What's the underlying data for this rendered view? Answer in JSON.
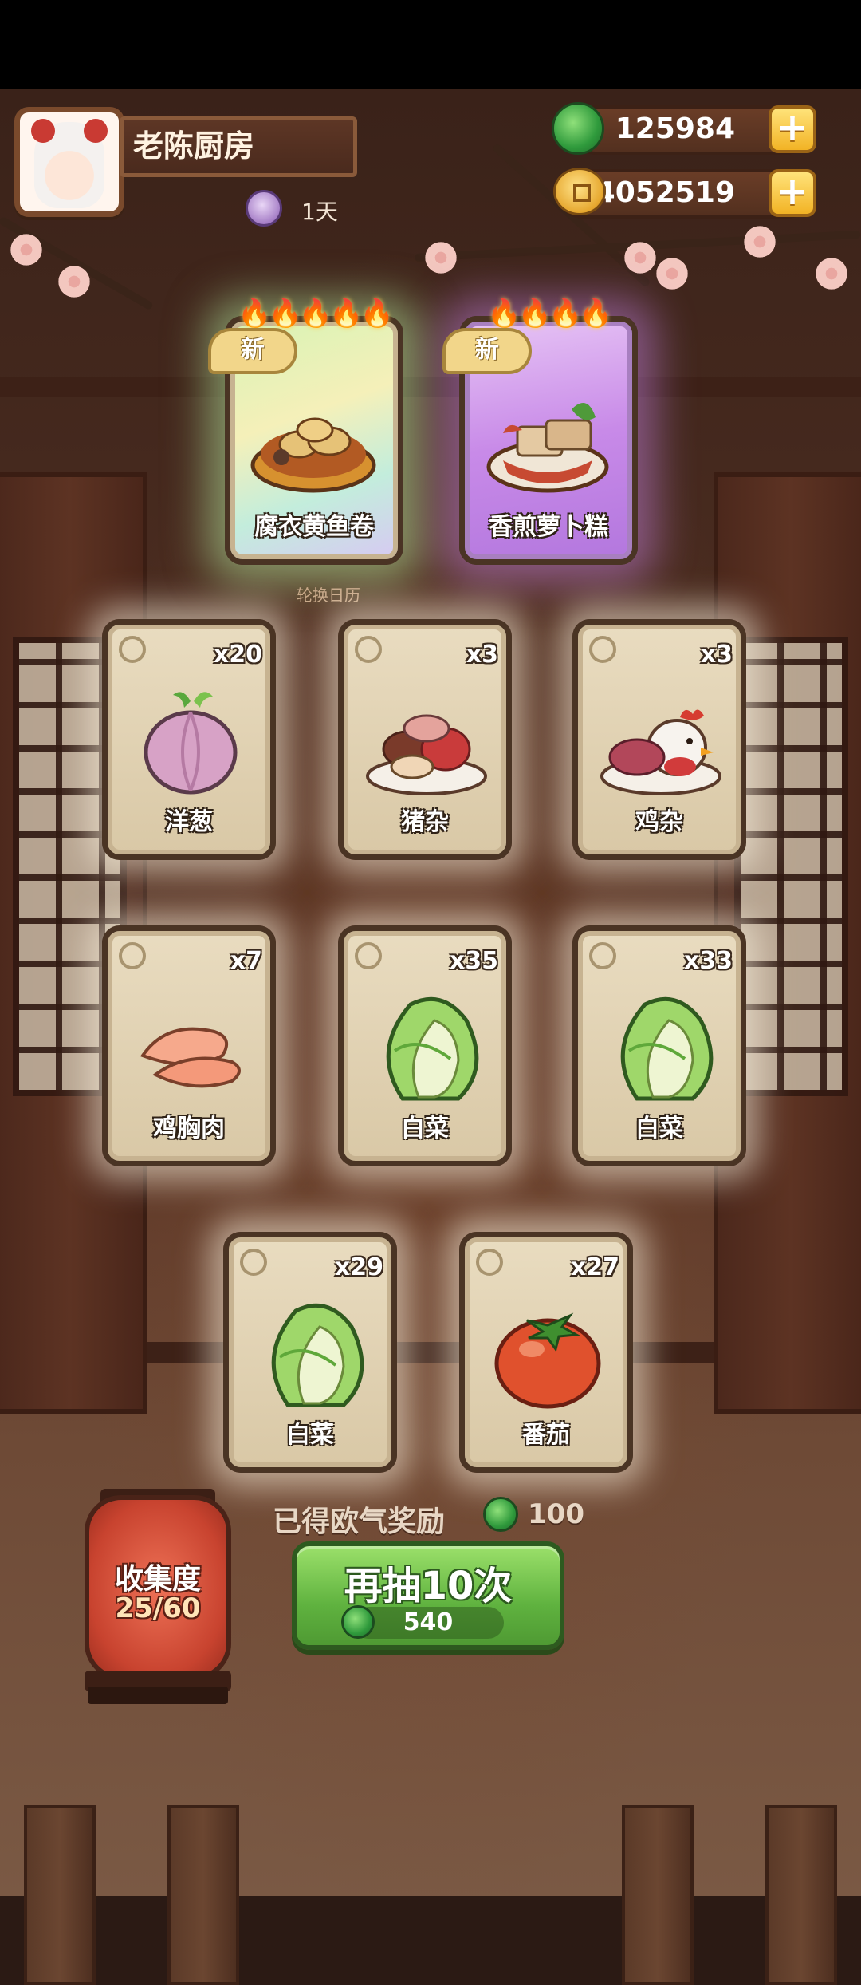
{
  "header": {
    "restaurant_name": "老陈厨房",
    "day_label": "1天"
  },
  "currencies": {
    "jade": {
      "value": "125984",
      "icon": "jade-icon"
    },
    "gold": {
      "value": "34052519",
      "icon": "coin-icon"
    }
  },
  "featured": {
    "rotate_label": "轮换日历",
    "cards": [
      {
        "label": "腐衣黄鱼卷",
        "badge": "新",
        "stars": 5,
        "color": "#c7f2a8"
      },
      {
        "label": "香煎萝卜糕",
        "badge": "新",
        "stars": 4,
        "color": "#c88ae8"
      }
    ]
  },
  "cards": [
    {
      "label": "洋葱",
      "qty": "x20",
      "icon": "onion-icon"
    },
    {
      "label": "猪杂",
      "qty": "x3",
      "icon": "pork-offal-icon"
    },
    {
      "label": "鸡杂",
      "qty": "x3",
      "icon": "chicken-offal-icon"
    },
    {
      "label": "鸡胸肉",
      "qty": "x7",
      "icon": "chicken-breast-icon"
    },
    {
      "label": "白菜",
      "qty": "x35",
      "icon": "cabbage-icon"
    },
    {
      "label": "白菜",
      "qty": "x33",
      "icon": "cabbage-icon"
    },
    {
      "label": "白菜",
      "qty": "x29",
      "icon": "cabbage-icon"
    },
    {
      "label": "番茄",
      "qty": "x27",
      "icon": "tomato-icon"
    }
  ],
  "reward": {
    "label": "已得欧气奖励",
    "value": "100"
  },
  "draw_button": {
    "label": "再抽10次",
    "cost": "540"
  },
  "collection": {
    "label": "收集度",
    "progress_text": "25/60",
    "progress": 0.4167
  }
}
